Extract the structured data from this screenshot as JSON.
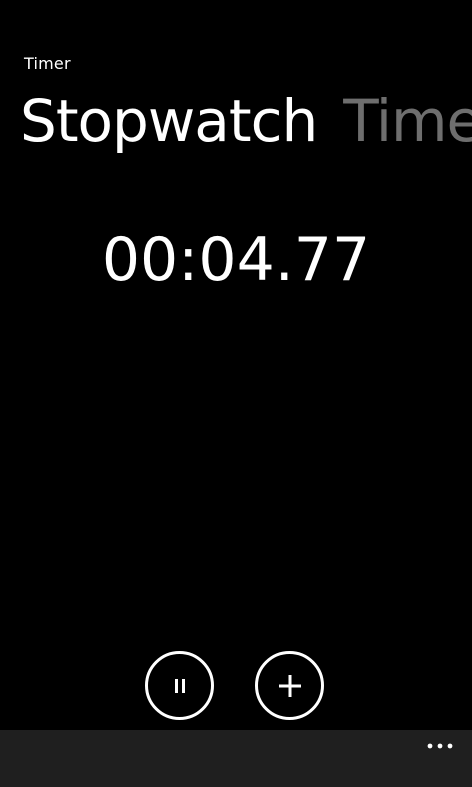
{
  "app": {
    "title": "Timer"
  },
  "pivot": {
    "items": [
      {
        "label": "Stopwatch",
        "active": true
      },
      {
        "label": "Timer",
        "active": false
      }
    ]
  },
  "stopwatch": {
    "elapsed": "00:04.77"
  },
  "controls": {
    "pause_icon": "pause-icon",
    "lap_icon": "plus-icon"
  },
  "app_bar": {
    "more_icon": "ellipsis-icon",
    "background": "#1f1f1f"
  },
  "colors": {
    "background": "#000000",
    "foreground": "#ffffff",
    "inactive_pivot": "#6e6e6e"
  }
}
